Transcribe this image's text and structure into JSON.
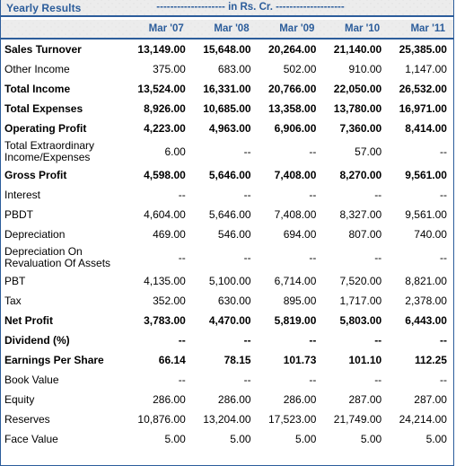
{
  "panel": {
    "title": "Yearly Results",
    "unit_note": "-------------------- in Rs. Cr. --------------------",
    "accent_color": "#2c5d9b",
    "header_bg_color": "#ececec",
    "text_color": "#000000"
  },
  "table": {
    "row_label_header": "",
    "columns": [
      "Mar '07",
      "Mar '08",
      "Mar '09",
      "Mar '10",
      "Mar '11"
    ],
    "rows": [
      {
        "label": "Sales Turnover",
        "bold": true,
        "values": [
          "13,149.00",
          "15,648.00",
          "20,264.00",
          "21,140.00",
          "25,385.00"
        ]
      },
      {
        "label": "Other Income",
        "bold": false,
        "values": [
          "375.00",
          "683.00",
          "502.00",
          "910.00",
          "1,147.00"
        ]
      },
      {
        "label": "Total Income",
        "bold": true,
        "values": [
          "13,524.00",
          "16,331.00",
          "20,766.00",
          "22,050.00",
          "26,532.00"
        ]
      },
      {
        "label": "Total Expenses",
        "bold": true,
        "values": [
          "8,926.00",
          "10,685.00",
          "13,358.00",
          "13,780.00",
          "16,971.00"
        ]
      },
      {
        "label": "Operating Profit",
        "bold": true,
        "values": [
          "4,223.00",
          "4,963.00",
          "6,906.00",
          "7,360.00",
          "8,414.00"
        ]
      },
      {
        "label": "Total Extraordinary Income/Expenses",
        "bold": false,
        "two_line": true,
        "values": [
          "6.00",
          "--",
          "--",
          "57.00",
          "--"
        ]
      },
      {
        "label": "Gross Profit",
        "bold": true,
        "values": [
          "4,598.00",
          "5,646.00",
          "7,408.00",
          "8,270.00",
          "9,561.00"
        ]
      },
      {
        "label": "Interest",
        "bold": false,
        "values": [
          "--",
          "--",
          "--",
          "--",
          "--"
        ]
      },
      {
        "label": "PBDT",
        "bold": false,
        "values": [
          "4,604.00",
          "5,646.00",
          "7,408.00",
          "8,327.00",
          "9,561.00"
        ]
      },
      {
        "label": "Depreciation",
        "bold": false,
        "values": [
          "469.00",
          "546.00",
          "694.00",
          "807.00",
          "740.00"
        ]
      },
      {
        "label": "Depreciation On Revaluation Of Assets",
        "bold": false,
        "two_line": true,
        "values": [
          "--",
          "--",
          "--",
          "--",
          "--"
        ]
      },
      {
        "label": "PBT",
        "bold": false,
        "values": [
          "4,135.00",
          "5,100.00",
          "6,714.00",
          "7,520.00",
          "8,821.00"
        ]
      },
      {
        "label": "Tax",
        "bold": false,
        "values": [
          "352.00",
          "630.00",
          "895.00",
          "1,717.00",
          "2,378.00"
        ]
      },
      {
        "label": "Net Profit",
        "bold": true,
        "values": [
          "3,783.00",
          "4,470.00",
          "5,819.00",
          "5,803.00",
          "6,443.00"
        ]
      },
      {
        "label": "Dividend (%)",
        "bold": true,
        "values": [
          "--",
          "--",
          "--",
          "--",
          "--"
        ]
      },
      {
        "label": "Earnings Per Share",
        "bold": true,
        "values": [
          "66.14",
          "78.15",
          "101.73",
          "101.10",
          "112.25"
        ]
      },
      {
        "label": "Book Value",
        "bold": false,
        "values": [
          "--",
          "--",
          "--",
          "--",
          "--"
        ]
      },
      {
        "label": "Equity",
        "bold": false,
        "values": [
          "286.00",
          "286.00",
          "286.00",
          "287.00",
          "287.00"
        ]
      },
      {
        "label": "Reserves",
        "bold": false,
        "values": [
          "10,876.00",
          "13,204.00",
          "17,523.00",
          "21,749.00",
          "24,214.00"
        ]
      },
      {
        "label": "Face Value",
        "bold": false,
        "values": [
          "5.00",
          "5.00",
          "5.00",
          "5.00",
          "5.00"
        ]
      }
    ]
  }
}
